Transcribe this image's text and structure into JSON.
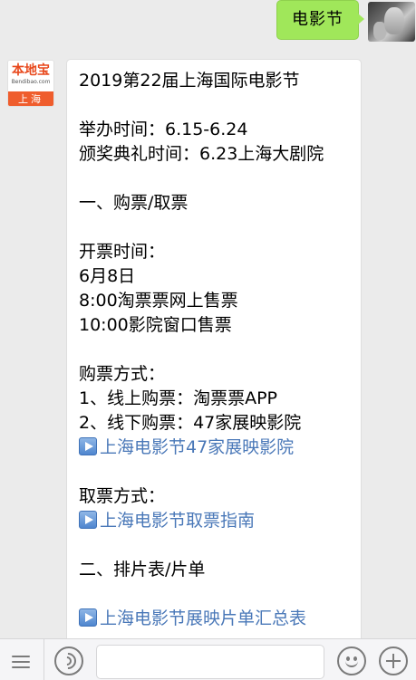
{
  "outgoing": {
    "text": "电影节"
  },
  "sender_avatar": {
    "brand": "本地宝",
    "domain": "Bendibao.com",
    "city": "上海"
  },
  "message": {
    "title": "2019第22届上海国际电影节",
    "held_time": "举办时间：6.15-6.24",
    "award_time": "颁奖典礼时间：6.23上海大剧院",
    "section1": "一、购票/取票",
    "open_label": "开票时间：",
    "open_date": "6月8日",
    "online_sale": "8:00淘票票网上售票",
    "window_sale": "10:00影院窗口售票",
    "buy_label": "购票方式：",
    "buy_online": "1、线上购票：淘票票APP",
    "buy_offline": "2、线下购票：47家展映影院",
    "link_cinemas": "上海电影节47家展映影院",
    "pickup_label": "取票方式：",
    "link_pickup": "上海电影节取票指南",
    "section2": "二、排片表/片单",
    "link_schedule": "上海电影节展映片单汇总表"
  },
  "input_bar": {
    "text_value": "",
    "icons": [
      "menu-icon",
      "voice-icon",
      "emoji-icon",
      "plus-icon"
    ]
  },
  "colors": {
    "background": "#ebebeb",
    "outgoing_bubble": "#a0e75a",
    "link": "#4a78b8",
    "brand_orange": "#ef5d2d"
  }
}
